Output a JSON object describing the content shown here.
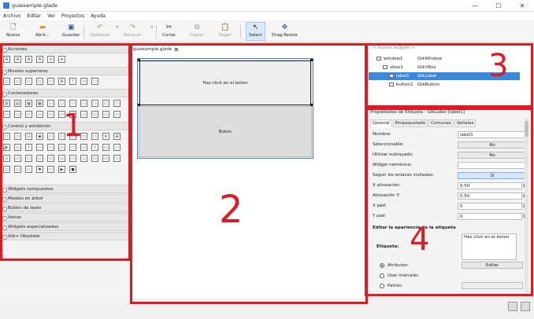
{
  "window": {
    "title": "guiexample.glade",
    "minimize": "—",
    "maximize": "☐",
    "close": "✕"
  },
  "menu": [
    "Archivo",
    "Editar",
    "Ver",
    "Proyectos",
    "Ayuda"
  ],
  "toolbar": {
    "nuevo": "Nuevo",
    "abrir": "Abrir...",
    "guardar": "Guardar",
    "deshacer": "Deshacer",
    "rehacer": "Rehacer",
    "cortar": "Cortar",
    "copiar": "Copiar",
    "pegar": "Pegar",
    "select": "Select",
    "drag": "Drag Resize"
  },
  "palette": {
    "sections": [
      "Acciones",
      "Niveles superiores",
      "Contenedores",
      "Control y exhibición",
      "Widgets compuestos",
      "Modelo en árbol",
      "Búfers de texto",
      "Varios",
      "Widgets especializados",
      "Gtk+ Obsolete"
    ]
  },
  "editor": {
    "tab": "guiexample.glade",
    "close": "⊠",
    "label_text": "Haz click en el boton",
    "button_text": "Boton"
  },
  "inspector": {
    "search_placeholder": "< buscar widgets >",
    "tree": [
      {
        "name": "window1",
        "type": "GtkWindow"
      },
      {
        "name": "vbox1",
        "type": "GtkVBox"
      },
      {
        "name": "label1",
        "type": "GtkLabel"
      },
      {
        "name": "button1",
        "type": "GtkButton"
      }
    ]
  },
  "properties": {
    "header": "Propiedades de Etiqueta - GtkLabel [label1]",
    "tabs": [
      "General",
      "Empaquetado",
      "Comunes",
      "Señales"
    ],
    "name_label": "Nombre:",
    "name_value": "label1",
    "selectable_label": "Seleccionable:",
    "selectable_value": "No",
    "underline_label": "Utilizar subrayado:",
    "underline_value": "No",
    "mnemonic_label": "Widget nemónico:",
    "visited_label": "Seguir los enlaces visitados:",
    "visited_value": "Sí",
    "xalign_label": "X alineación:",
    "xalign_value": "0.50",
    "yalign_label": "Alineación Y:",
    "yalign_value": "0.50",
    "xpad_label": "X pad:",
    "xpad_value": "0",
    "ypad_label": "Y pad:",
    "ypad_value": "0",
    "section_label": "Editar la apariencia de la etiqueta",
    "etiqueta_label": "Etiqueta:",
    "etiqueta_value": "Haz click en el boton",
    "attr_label": "Atributos:",
    "edit_button": "Editar",
    "markup_label": "User marcado:",
    "pattern_label": "Patrón:"
  },
  "annotations": [
    "1",
    "2",
    "3",
    "4"
  ],
  "colors": {
    "annotation": "#e01a22",
    "selection": "#3b8ad9"
  }
}
